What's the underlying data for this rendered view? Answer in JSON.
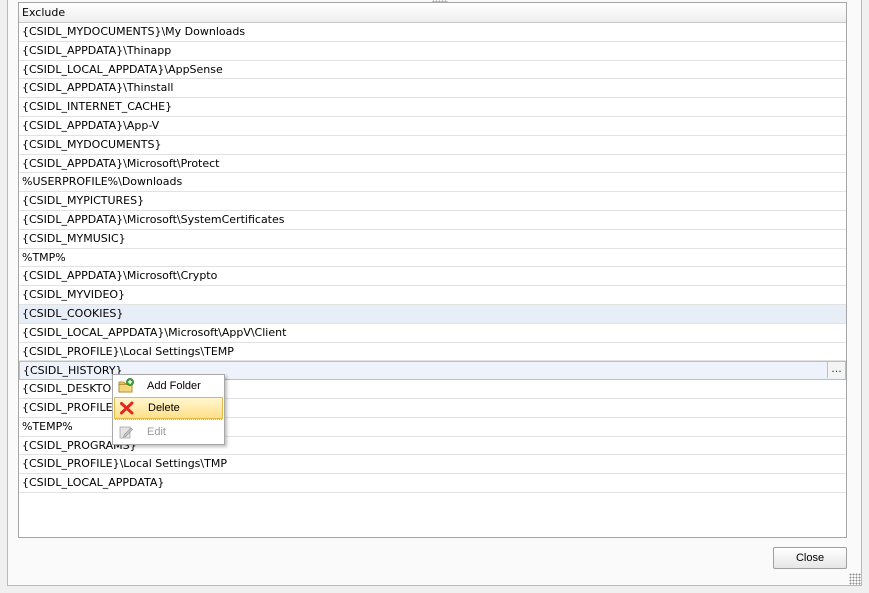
{
  "grid": {
    "column_header": "Exclude",
    "rows": [
      "{CSIDL_MYDOCUMENTS}\\My Downloads",
      "{CSIDL_APPDATA}\\Thinapp",
      "{CSIDL_LOCAL_APPDATA}\\AppSense",
      "{CSIDL_APPDATA}\\Thinstall",
      "{CSIDL_INTERNET_CACHE}",
      "{CSIDL_APPDATA}\\App-V",
      "{CSIDL_MYDOCUMENTS}",
      "{CSIDL_APPDATA}\\Microsoft\\Protect",
      "%USERPROFILE%\\Downloads",
      "{CSIDL_MYPICTURES}",
      "{CSIDL_APPDATA}\\Microsoft\\SystemCertificates",
      "{CSIDL_MYMUSIC}",
      "%TMP%",
      "{CSIDL_APPDATA}\\Microsoft\\Crypto",
      "{CSIDL_MYVIDEO}",
      "{CSIDL_COOKIES}",
      "{CSIDL_LOCAL_APPDATA}\\Microsoft\\AppV\\Client",
      "{CSIDL_PROFILE}\\Local Settings\\TEMP",
      "{CSIDL_HISTORY}",
      "{CSIDL_DESKTOPD",
      "{CSIDL_PROFILE}\\",
      "%TEMP%",
      "{CSIDL_PROGRAMS}",
      "{CSIDL_PROFILE}\\Local Settings\\TMP",
      "{CSIDL_LOCAL_APPDATA}"
    ],
    "selected_row": "{CSIDL_COOKIES}",
    "editing_row": "{CSIDL_HISTORY}",
    "ellipsis_label": "..."
  },
  "context_menu": {
    "items": [
      {
        "label": "Add Folder",
        "icon": "add-folder-icon",
        "state": "enabled"
      },
      {
        "label": "Delete",
        "icon": "delete-icon",
        "state": "highlighted"
      },
      {
        "label": "Edit",
        "icon": "edit-icon",
        "state": "disabled"
      }
    ]
  },
  "footer": {
    "close_label": "Close"
  },
  "colors": {
    "selected_row": "#e8eef8",
    "menu_highlight": "#ffe08a",
    "delete_icon": "#e02a1e"
  }
}
